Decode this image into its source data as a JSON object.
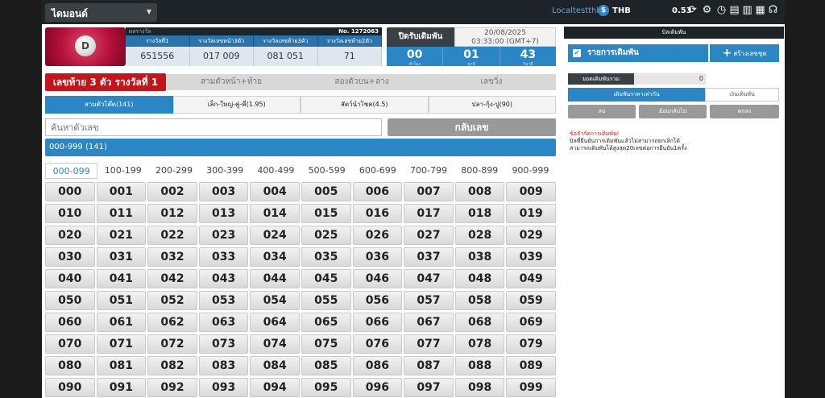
{
  "header": {
    "site_name": "ไดมอนด์",
    "username": "Localtestthb2",
    "currency": "THB",
    "balance": "0.53"
  },
  "logo": {
    "letter": "D"
  },
  "result": {
    "label": "ผลรางวัล",
    "round_no": "No. 1272063",
    "columns": [
      "รางวัลที่1",
      "รางวัลเลขหน้า3ตัว",
      "รางวัลเลขท้าย3ตัว",
      "รางวัลเลขท้าย2ตัว"
    ],
    "values": [
      "651556",
      "017  009",
      "081  051",
      "71"
    ]
  },
  "close": {
    "label": "ปิดรับเดิมพัน",
    "date": "20/08/2025",
    "time": "03:33:00 (GMT+7)",
    "countdown": [
      {
        "value": "00",
        "unit": "ชั่วโมง"
      },
      {
        "value": "01",
        "unit": "นาที"
      },
      {
        "value": "43",
        "unit": "วินาที"
      }
    ]
  },
  "bet_tabs": [
    "เลขท้าย 3 ตัว รางวัลที่ 1",
    "สามตัวหน้า+ท้าย",
    "สองตัวบน+ล่าง",
    "เลขวิ่ง"
  ],
  "sub_tabs": [
    "สามตัวโต๊ด(141)",
    "เล็ก-ใหญ่-คู่-คี่(1.95)",
    "สัตว์นำโชค(4.5)",
    "ปลา-กุ้ง-ปู(90)"
  ],
  "search": {
    "placeholder": "ค้นหาตัวเลข",
    "back_label": "กลับเลข"
  },
  "range_bar_label": "000-999 (141)",
  "ranges": [
    "000-099",
    "100-199",
    "200-299",
    "300-399",
    "400-499",
    "500-599",
    "600-699",
    "700-799",
    "800-899",
    "900-999"
  ],
  "numbers": [
    "000",
    "001",
    "002",
    "003",
    "004",
    "005",
    "006",
    "007",
    "008",
    "009",
    "010",
    "011",
    "012",
    "013",
    "014",
    "015",
    "016",
    "017",
    "018",
    "019",
    "020",
    "021",
    "022",
    "023",
    "024",
    "025",
    "026",
    "027",
    "028",
    "029",
    "030",
    "031",
    "032",
    "033",
    "034",
    "035",
    "036",
    "037",
    "038",
    "039",
    "040",
    "041",
    "042",
    "043",
    "044",
    "045",
    "046",
    "047",
    "048",
    "049",
    "050",
    "051",
    "052",
    "053",
    "054",
    "055",
    "056",
    "057",
    "058",
    "059",
    "060",
    "061",
    "062",
    "063",
    "064",
    "065",
    "066",
    "067",
    "068",
    "069",
    "070",
    "071",
    "072",
    "073",
    "074",
    "075",
    "076",
    "077",
    "078",
    "079",
    "080",
    "081",
    "082",
    "083",
    "084",
    "085",
    "086",
    "087",
    "088",
    "089",
    "090",
    "091",
    "092",
    "093",
    "094",
    "095",
    "096",
    "097",
    "098",
    "099"
  ],
  "right_panel": {
    "title": "บิลเดิมพัน",
    "list_label": "รายการเดิมพัน",
    "create_label": "สร้างเลขชุด",
    "total_label": "ยอดเดิมพันรวม",
    "total_value": "0",
    "mode_same": "เดิมพันราคาเท่ากัน",
    "mode_amount": "เงินเดิมพัน",
    "buttons": [
      "ลบ",
      "ย้อนกลับไป",
      "ตกลง"
    ],
    "note_title": "ข้อจำกัดการเดิมพัน!",
    "note_lines": [
      "บิลที่ยืนยันการเดิมพันแล้วไม่สามารถยกเลิกได้",
      "สามารถเดิมพันได้สูงสุด20เลขต่อการยืนยัน1ครั้ง"
    ]
  },
  "colors": {
    "accent_blue": "#2b86c6",
    "accent_red": "#c4151b",
    "dark": "#1d2327"
  }
}
